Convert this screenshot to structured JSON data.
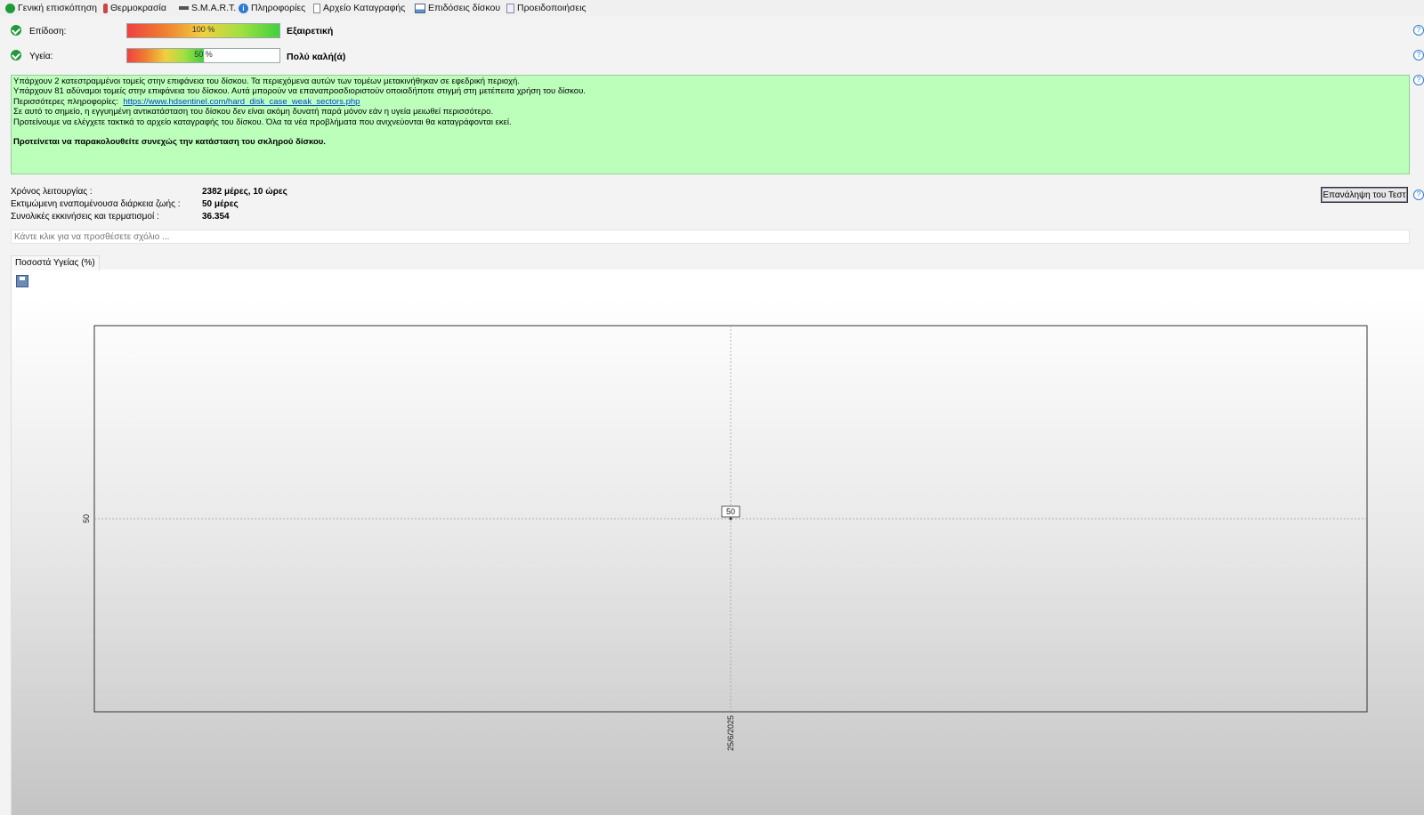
{
  "tabs": [
    {
      "label": "Γενική επισκόπηση",
      "icon": "check-icon"
    },
    {
      "label": "Θερμοκρασία",
      "icon": "thermometer-icon"
    },
    {
      "label": "S.M.A.R.T.",
      "icon": "disk-icon"
    },
    {
      "label": "Πληροφορίες",
      "icon": "info-icon"
    },
    {
      "label": "Αρχείο Καταγραφής",
      "icon": "document-icon"
    },
    {
      "label": "Επιδόσεις δίσκου",
      "icon": "chart-icon"
    },
    {
      "label": "Προειδοποιήσεις",
      "icon": "warning-doc-icon"
    }
  ],
  "performance": {
    "label": "Επίδοση:",
    "percent_text": "100 %",
    "value": 100,
    "rating": "Εξαιρετική"
  },
  "health": {
    "label": "Υγεία:",
    "percent_text": "50 %",
    "value": 50,
    "rating": "Πολύ καλή(ά)"
  },
  "message": {
    "line1": "Υπάρχουν 2 κατεστραμμένοι τομείς στην επιφάνεια του δίσκου. Τα περιεχόμενα αυτών των τομέων μετακινήθηκαν σε εφεδρική περιοχή.",
    "line2": "Υπάρχουν 81 αδύναμοι τομείς στην επιφάνεια του δίσκου. Αυτά μπορούν να επαναπροσδιοριστούν οποιαδήποτε στιγμή στη μετέπειτα χρήση του δίσκου.",
    "more_label": "Περισσότερες πληροφορίες:",
    "more_link": "https://www.hdsentinel.com/hard_disk_case_weak_sectors.php",
    "line4": "Σε αυτό το σημείο, η εγγυημένη αντικατάσταση του δίσκου δεν είναι ακόμη δυνατή παρά μόνον εάν η υγεία μειωθεί περισσότερο.",
    "line5": "Προτείνουμε να ελέγχετε τακτικά το αρχείο καταγραφής του δίσκου. Όλα τα νέα προβλήματα που ανιχνεύονται θα καταγράφονται εκεί.",
    "bold_line": "Προτείνεται να παρακολουθείτε συνεχώς την κατάσταση του σκληρού δίσκου."
  },
  "info": {
    "uptime_label": "Χρόνος λειτουργίας :",
    "uptime_value": "2382 μέρες, 10 ώρες",
    "lifetime_label": "Εκτιμώμενη εναπομένουσα διάρκεια ζωής :",
    "lifetime_value": "50 μέρες",
    "starts_label": "Συνολικές εκκινήσεις και τερματισμοί :",
    "starts_value": "36.354"
  },
  "retest_button": "Επανάληψη του Τεστ",
  "comment_placeholder": "Κάντε κλικ για να προσθέσετε σχόλιο ...",
  "chart_tab": "Ποσοστά Υγείας (%)",
  "chart_data": {
    "type": "line",
    "x": [
      "25/6/2025"
    ],
    "series": [
      {
        "values": [
          50
        ]
      }
    ],
    "ytick_labels": [
      "50"
    ],
    "data_labels": [
      "50"
    ],
    "grid": true
  }
}
